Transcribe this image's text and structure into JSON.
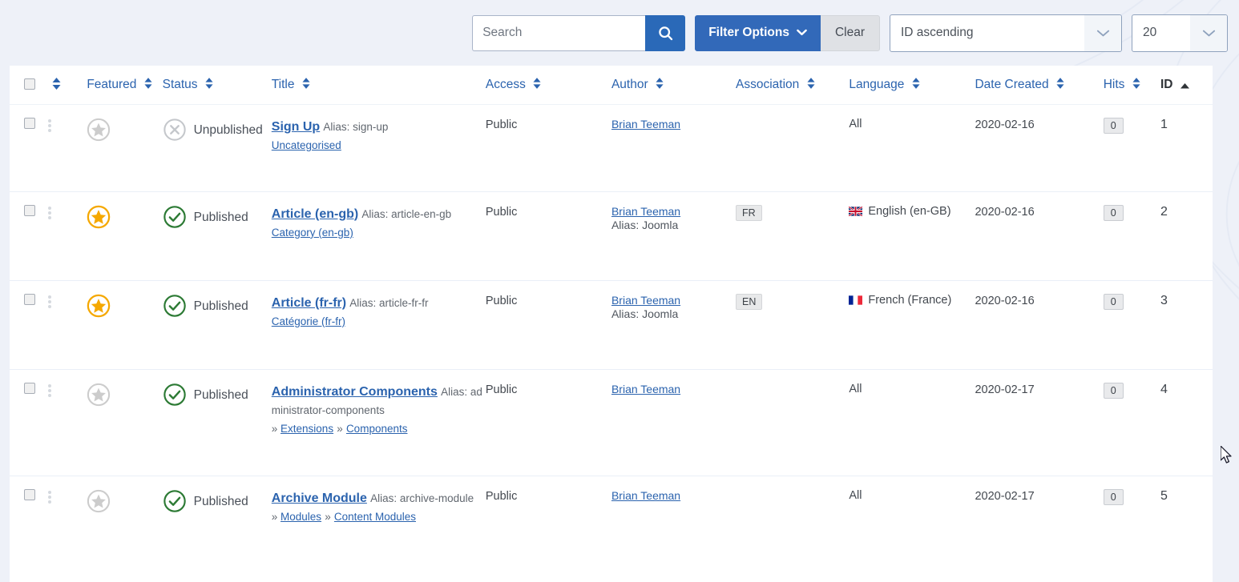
{
  "toolbar": {
    "search_placeholder": "Search",
    "search_value": "",
    "search_icon": "search-icon",
    "filter_options_label": "Filter Options",
    "filter_chevron_icon": "chevron-down-icon",
    "clear_label": "Clear",
    "sort_selected": "ID ascending",
    "sort_chevron_icon": "chevron-down-icon",
    "limit_selected": "20",
    "limit_chevron_icon": "chevron-down-icon"
  },
  "colors": {
    "primary_blue": "#3269b9",
    "search_button_blue": "#2a69b8",
    "link_blue": "#2b63ae",
    "star_featured": "#f5a800",
    "star_unfeatured": "#cccccc",
    "published_green": "#2c7a34",
    "unpublished_grey": "#c4c7cb",
    "page_background": "#eef1f8",
    "table_background": "#ffffff",
    "row_border": "#eaeff7"
  },
  "table": {
    "headers": [
      {
        "key": "check",
        "label": "",
        "sortable": false,
        "sorted": null
      },
      {
        "key": "order",
        "label": "",
        "sortable": true,
        "sorted": null
      },
      {
        "key": "featured",
        "label": "Featured",
        "sortable": true,
        "sorted": null
      },
      {
        "key": "status",
        "label": "Status",
        "sortable": true,
        "sorted": null
      },
      {
        "key": "title",
        "label": "Title",
        "sortable": true,
        "sorted": null
      },
      {
        "key": "access",
        "label": "Access",
        "sortable": true,
        "sorted": null
      },
      {
        "key": "author",
        "label": "Author",
        "sortable": true,
        "sorted": null
      },
      {
        "key": "assoc",
        "label": "Association",
        "sortable": true,
        "sorted": null
      },
      {
        "key": "language",
        "label": "Language",
        "sortable": true,
        "sorted": null
      },
      {
        "key": "date",
        "label": "Date Created",
        "sortable": true,
        "sorted": null
      },
      {
        "key": "hits",
        "label": "Hits",
        "sortable": true,
        "sorted": null
      },
      {
        "key": "id",
        "label": "ID",
        "sortable": true,
        "sorted": "asc"
      }
    ],
    "rows": [
      {
        "featured": false,
        "status": "Unpublished",
        "status_icon": "circle-x-icon",
        "title": "Sign Up",
        "alias": "Alias: sign-up",
        "category": "Uncategorised",
        "path": [],
        "access": "Public",
        "author": "Brian Teeman",
        "author_alias": "",
        "association": "",
        "language": "All",
        "language_flag": "",
        "date_created": "2020-02-16",
        "hits": "0",
        "id": "1"
      },
      {
        "featured": true,
        "status": "Published",
        "status_icon": "circle-check-icon",
        "title": "Article (en-gb)",
        "alias": "Alias: article-en-gb",
        "category": "Category (en-gb)",
        "path": [],
        "access": "Public",
        "author": "Brian Teeman",
        "author_alias": "Alias: Joomla",
        "association": "FR",
        "language": "English (en-GB)",
        "language_flag": "gb",
        "date_created": "2020-02-16",
        "hits": "0",
        "id": "2"
      },
      {
        "featured": true,
        "status": "Published",
        "status_icon": "circle-check-icon",
        "title": "Article (fr-fr)",
        "alias": "Alias: article-fr-fr",
        "category": "Catégorie (fr-fr)",
        "path": [],
        "access": "Public",
        "author": "Brian Teeman",
        "author_alias": "Alias: Joomla",
        "association": "EN",
        "language": "French (France)",
        "language_flag": "fr",
        "date_created": "2020-02-16",
        "hits": "0",
        "id": "3"
      },
      {
        "featured": false,
        "status": "Published",
        "status_icon": "circle-check-icon",
        "title": "Administrator Components",
        "alias": "Alias: administrator-components",
        "category": "",
        "path": [
          "Extensions",
          "Components"
        ],
        "access": "Public",
        "author": "Brian Teeman",
        "author_alias": "",
        "association": "",
        "language": "All",
        "language_flag": "",
        "date_created": "2020-02-17",
        "hits": "0",
        "id": "4"
      },
      {
        "featured": false,
        "status": "Published",
        "status_icon": "circle-check-icon",
        "title": "Archive Module",
        "alias": "Alias: archive-module",
        "category": "",
        "path": [
          "Modules",
          "Content Modules"
        ],
        "access": "Public",
        "author": "Brian Teeman",
        "author_alias": "",
        "association": "",
        "language": "All",
        "language_flag": "",
        "date_created": "2020-02-17",
        "hits": "0",
        "id": "5"
      }
    ]
  }
}
